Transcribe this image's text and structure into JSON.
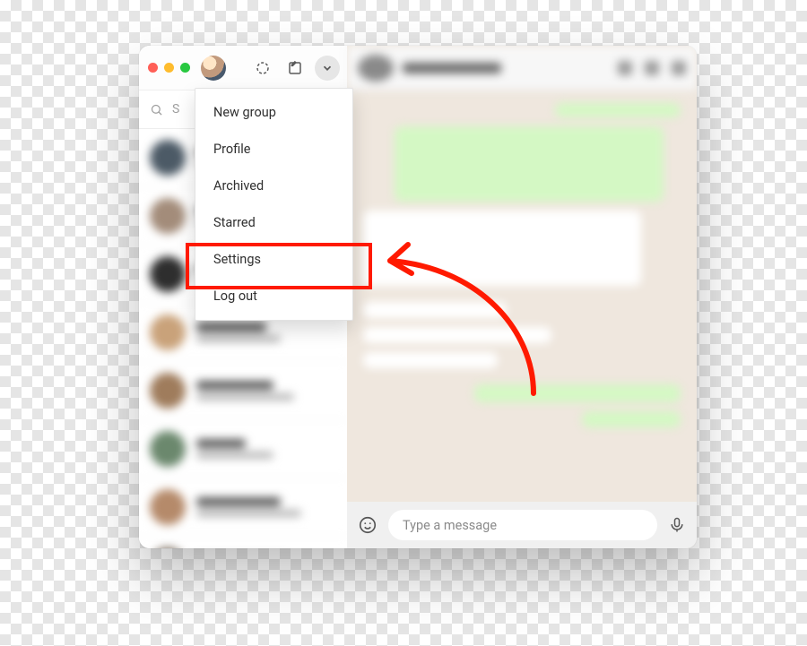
{
  "dropdown": {
    "items": [
      {
        "label": "New group"
      },
      {
        "label": "Profile"
      },
      {
        "label": "Archived"
      },
      {
        "label": "Starred"
      },
      {
        "label": "Settings"
      },
      {
        "label": "Log out"
      }
    ]
  },
  "search": {
    "placeholder_initial": "S"
  },
  "composer": {
    "placeholder": "Type a message"
  },
  "chat_avatar_colors": [
    "#4c5a66",
    "#a38c7a",
    "#2e2e2e",
    "#c9a27a",
    "#9f7c5c",
    "#6b886d",
    "#b58a6a",
    "#7a6b5c"
  ],
  "right_avatar_color": "#8a8a8a",
  "annotation": {
    "color": "#ff1a00"
  }
}
